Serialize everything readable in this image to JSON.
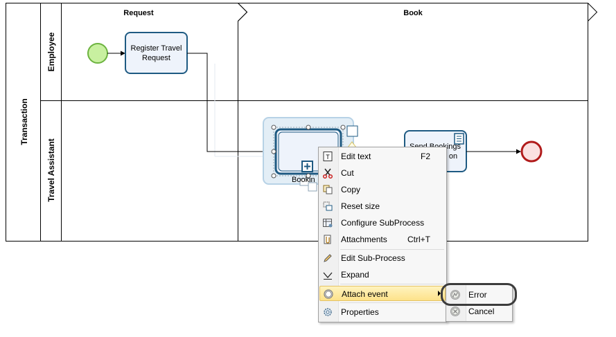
{
  "diagram": {
    "pool_label": "Transaction",
    "lanes": [
      "Employee",
      "Travel Assistant"
    ],
    "phases": [
      "Request",
      "Book"
    ],
    "tasks": {
      "register": "Register Travel Request",
      "register_lines": [
        "Register Travel",
        "Request"
      ],
      "bookings_partial": "Bookin",
      "send_bookings_lines": [
        "Send Bookings",
        "on"
      ]
    },
    "colors": {
      "start_event_fill": "#c8f0a0",
      "start_event_stroke": "#6cb33f",
      "end_event_fill": "#fbe1e1",
      "end_event_stroke": "#b11b1b",
      "task_fill": "#eef3fb",
      "task_stroke": "#1e5a82",
      "selection": "#b7d2e6"
    }
  },
  "context_menu": {
    "items": [
      {
        "label": "Edit text",
        "shortcut": "F2",
        "icon": "edit-text-icon"
      },
      {
        "label": "Cut",
        "icon": "scissors-icon"
      },
      {
        "label": "Copy",
        "icon": "copy-icon"
      },
      {
        "label": "Reset size",
        "icon": "reset-size-icon"
      },
      {
        "label": "Configure SubProcess",
        "icon": "configure-subprocess-icon"
      },
      {
        "label": "Attachments",
        "shortcut": "Ctrl+T",
        "icon": "attachments-icon"
      },
      {
        "label": "Edit Sub-Process",
        "icon": "pencil-icon"
      },
      {
        "label": "Expand",
        "icon": "expand-icon"
      },
      {
        "label": "Attach event",
        "icon": "attach-event-icon"
      },
      {
        "label": "Properties",
        "icon": "properties-icon"
      }
    ]
  },
  "submenu": {
    "items": [
      {
        "label": "Error",
        "icon": "error-event-icon"
      },
      {
        "label": "Cancel",
        "icon": "cancel-event-icon"
      }
    ]
  }
}
